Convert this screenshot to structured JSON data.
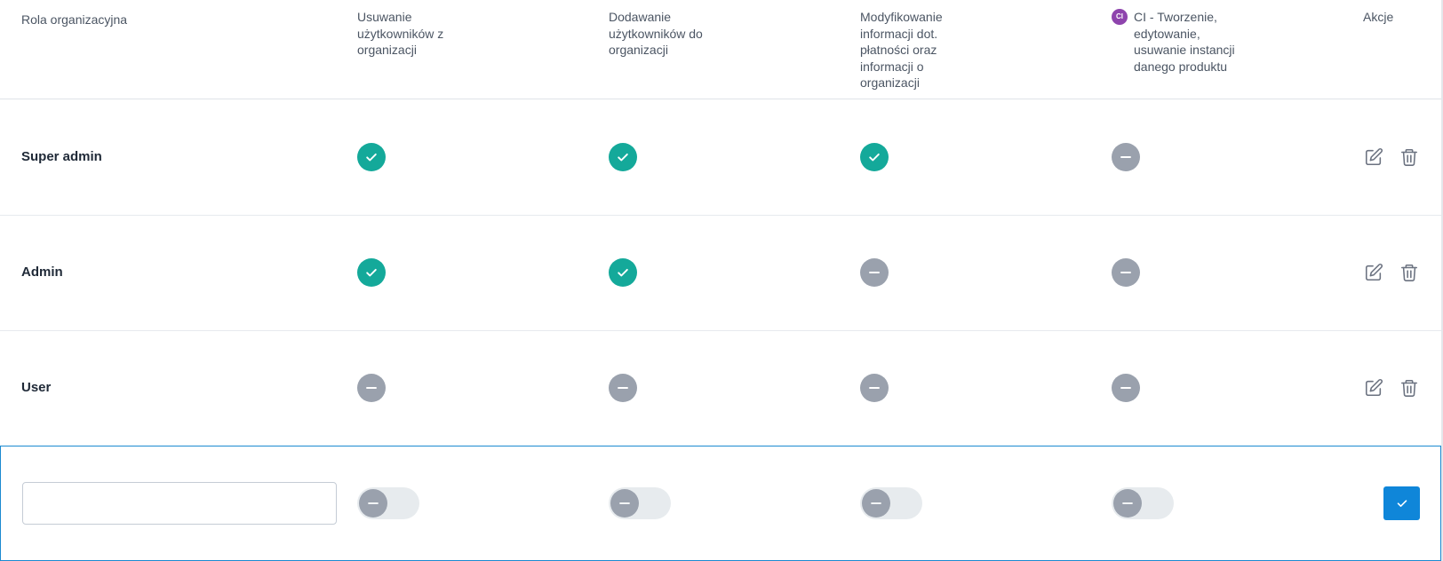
{
  "header": {
    "role": "Rola organizacyjna",
    "perm1": "Usuwanie użytkowników z organizacji",
    "perm2": "Dodawanie użytkowników do organizacji",
    "perm3": "Modyfikowanie informacji dot. płatności oraz informacji o organizacji",
    "perm4_badge": "CI",
    "perm4": "CI - Tworzenie, edytowanie, usuwanie instancji danego produktu",
    "actions": "Akcje"
  },
  "rows": [
    {
      "name": "Super admin",
      "perms": [
        true,
        true,
        true,
        false
      ]
    },
    {
      "name": "Admin",
      "perms": [
        true,
        true,
        false,
        false
      ]
    },
    {
      "name": "User",
      "perms": [
        false,
        false,
        false,
        false
      ]
    }
  ],
  "new_row": {
    "name_value": "",
    "toggles": [
      false,
      false,
      false,
      false
    ]
  },
  "colors": {
    "granted": "#14a99a",
    "denied": "#9aa1ad",
    "ci_badge": "#8e44ad",
    "accent": "#0f86d9"
  },
  "icons": {
    "granted": "check-icon",
    "denied": "minus-icon",
    "edit": "edit-icon",
    "delete": "trash-icon",
    "confirm": "check-icon"
  }
}
